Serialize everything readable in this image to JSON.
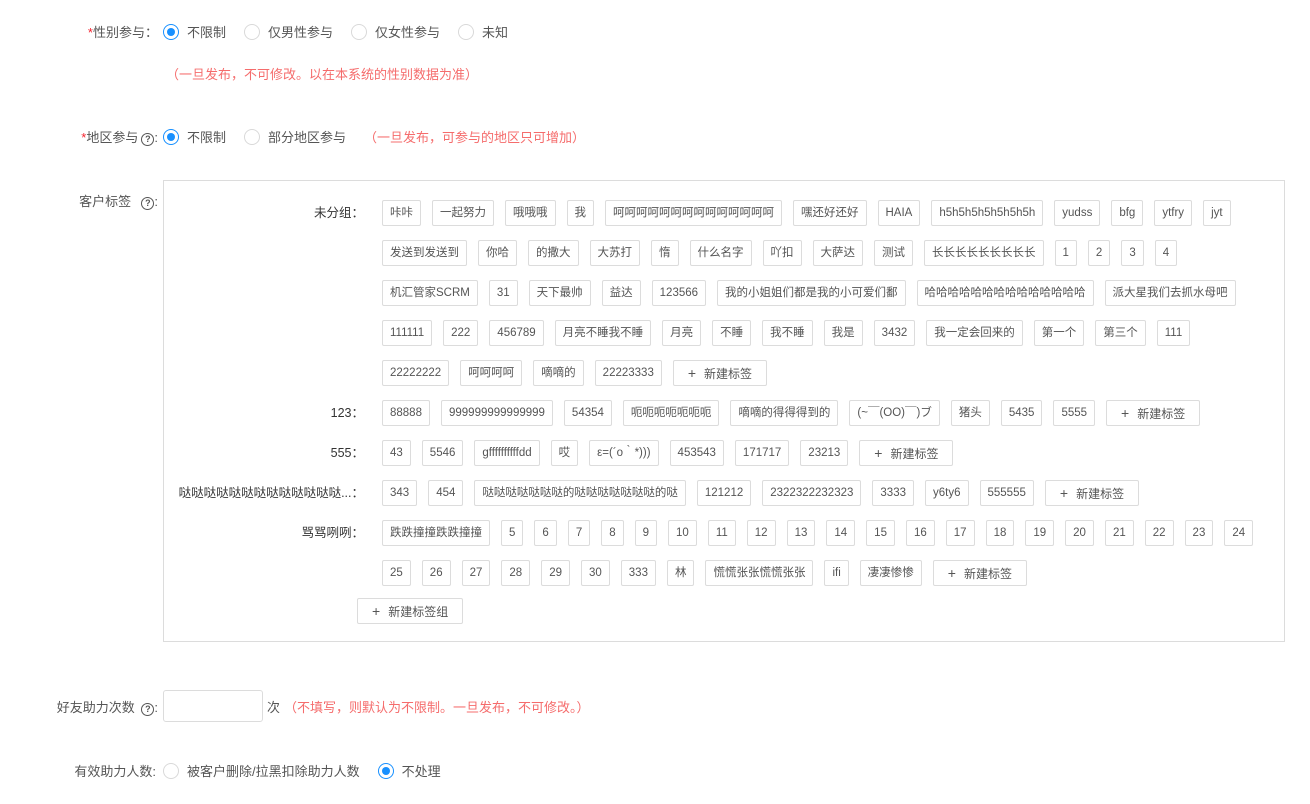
{
  "gender": {
    "required_mark": "*",
    "label": "性别参与：",
    "options": [
      "不限制",
      "仅男性参与",
      "仅女性参与",
      "未知"
    ],
    "selected": 0,
    "hint": "（一旦发布，不可修改。以在本系统的性别数据为准）"
  },
  "region": {
    "required_mark": "*",
    "label": "地区参与",
    "help": "?",
    "colon": ":",
    "options": [
      "不限制",
      "部分地区参与"
    ],
    "selected": 0,
    "hint": "（一旦发布，可参与的地区只可增加）"
  },
  "customer_tags": {
    "label": "客户标签",
    "help": "?",
    "colon": ":",
    "groups": [
      {
        "name": "未分组：",
        "tags": [
          "咔咔",
          "一起努力",
          "哦哦哦",
          "我",
          "呵呵呵呵呵呵呵呵呵呵呵呵呵呵",
          "嘿还好还好",
          "HAIA",
          "h5h5h5h5h5h5h5h",
          "yudss",
          "bfg",
          "ytfry",
          "jyt",
          "发送到发送到",
          "你哈",
          "的撒大",
          "大苏打",
          "惰",
          "什么名字",
          "吖扣",
          "大萨达",
          "测试",
          "长长长长长长长长长",
          "1",
          "2",
          "3",
          "4",
          "机汇管家SCRM",
          "31",
          "天下最帅",
          "益达",
          "123566",
          "我的小姐姐们都是我的小可爱们鄱",
          "哈哈哈哈哈哈哈哈哈哈哈哈哈哈",
          "派大星我们去抓水母吧",
          "111111",
          "222",
          "456789",
          "月亮不睡我不睡",
          "月亮",
          "不睡",
          "我不睡",
          "我是",
          "3432",
          "我一定会回来的",
          "第一个",
          "第三个",
          "111",
          "22222222",
          "呵呵呵呵",
          "嘀嘀的",
          "22223333"
        ],
        "add_label": "新建标签"
      },
      {
        "name": "123：",
        "tags": [
          "88888",
          "999999999999999",
          "54354",
          "呃呃呃呃呃呃呃",
          "嘀嘀的得得得到的",
          "(~￣(OO)￣)ブ",
          "猪头",
          "5435",
          "5555"
        ],
        "add_label": "新建标签"
      },
      {
        "name": "555：",
        "tags": [
          "43",
          "5546",
          "gffffffffffdd",
          "哎",
          "ε=(´ο｀*)))",
          "453543",
          "171717",
          "23213"
        ],
        "add_label": "新建标签"
      },
      {
        "name": "哒哒哒哒哒哒哒哒哒哒哒哒哒...：",
        "tags": [
          "343",
          "454",
          "哒哒哒哒哒哒哒的哒哒哒哒哒哒哒的哒",
          "121212",
          "2322322232323",
          "3333",
          "y6ty6",
          "555555"
        ],
        "add_label": "新建标签"
      },
      {
        "name": "骂骂咧咧：",
        "tags": [
          "跌跌撞撞跌跌撞撞",
          "5",
          "6",
          "7",
          "8",
          "9",
          "10",
          "11",
          "12",
          "13",
          "14",
          "15",
          "16",
          "17",
          "18",
          "19",
          "20",
          "21",
          "22",
          "23",
          "24",
          "25",
          "26",
          "27",
          "28",
          "29",
          "30",
          "333",
          "林",
          "慌慌张张慌慌张张",
          "ifi",
          "凄凄惨惨"
        ],
        "add_label": "新建标签"
      }
    ],
    "add_group_label": "新建标签组",
    "plus": "+"
  },
  "friend_help": {
    "label": "好友助力次数",
    "help": "?",
    "colon": ":",
    "input_value": "",
    "unit": "次",
    "hint": "（不填写，则默认为不限制。一旦发布，不可修改。）"
  },
  "valid_help": {
    "label": "有效助力人数:",
    "options": [
      "被客户删除/拉黑扣除助力人数",
      "不处理"
    ],
    "selected": 1
  },
  "colors": {
    "primary": "#1890ff",
    "hint": "#f56c6c",
    "required": "#f5222d",
    "border": "#dcdcdc"
  }
}
